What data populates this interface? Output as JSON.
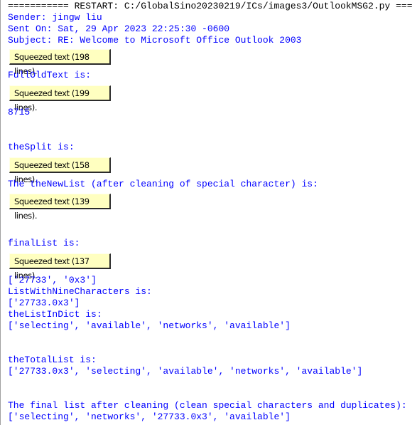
{
  "shell": {
    "restart_line": "=========== RESTART: C:/GlobalSino20230219/ICs/images3/OutlookMSG2.py ===",
    "output": {
      "sender": "Sender: jingw liu",
      "sent_on": "Sent On: Sat, 29 Apr 2023 22:25:30 -0600",
      "subject": "Subject: RE: Welcome to Microsoft Office Outlook 2003",
      "squeezed_1": "Squeezed text (198 lines).",
      "full_old_text_label": "FullOldText is:",
      "squeezed_2": "Squeezed text (199 lines).",
      "length_value": "8715",
      "the_split_label": "theSplit is:",
      "squeezed_3": "Squeezed text (158 lines).",
      "new_list_label": "The theNewList (after cleaning of special character) is:",
      "squeezed_4": "Squeezed text (139 lines).",
      "final_list_label": "finalList is:",
      "squeezed_5": "Squeezed text (137 lines).",
      "final_list_value": "['27733', '0x3']",
      "nine_chars_label": "ListWithNineCharacters is:",
      "nine_chars_value": "['27733.0x3']",
      "list_in_dict_label": "theListInDict is:",
      "list_in_dict_value": "['selecting', 'available', 'networks', 'available']",
      "total_list_label": "theTotalList is:",
      "total_list_value": "['27733.0x3', 'selecting', 'available', 'networks', 'available']",
      "cleaned_label": "The final list after cleaning (clean special characters and duplicates):",
      "cleaned_value": "['selecting', 'networks', '27733.0x3', 'available']"
    },
    "colors": {
      "output_text": "#0000ff",
      "restart_text": "#000000",
      "squeeze_bg": "#ffffc0"
    }
  }
}
